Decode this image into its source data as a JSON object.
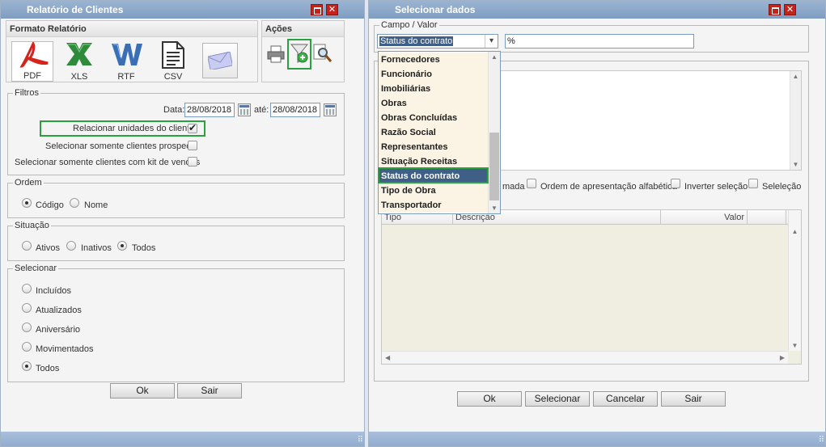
{
  "left_window": {
    "title": "Relatório de Clientes",
    "format_section": {
      "title": "Formato Relatório",
      "formats": [
        {
          "label": "PDF",
          "icon": "pdf-icon",
          "color": "#d4241c"
        },
        {
          "label": "XLS",
          "icon": "excel-icon",
          "color": "#2e8b3a"
        },
        {
          "label": "RTF",
          "icon": "word-icon",
          "color": "#3a6fb5"
        },
        {
          "label": "CSV",
          "icon": "csv-document-icon",
          "color": "#333333"
        },
        {
          "label": "",
          "icon": "email-envelope-icon",
          "color": "#8a8fc8"
        }
      ]
    },
    "actions_section": {
      "title": "Ações",
      "icons": [
        "printer-icon",
        "filter-add-icon",
        "preview-magnifier-icon"
      ]
    },
    "filtros": {
      "legend": "Filtros",
      "date_label": "Data:",
      "date_from": "28/08/2018",
      "ate_label": "até:",
      "date_to": "28/08/2018",
      "options": [
        {
          "label": "Relacionar unidades do cliente",
          "checked": true
        },
        {
          "label": "Selecionar somente clientes prospects",
          "checked": false
        },
        {
          "label": "Selecionar somente clientes com kit de vendas",
          "checked": false
        }
      ]
    },
    "ordem": {
      "legend": "Ordem",
      "options": [
        {
          "label": "Código",
          "selected": true
        },
        {
          "label": "Nome",
          "selected": false
        }
      ]
    },
    "situacao": {
      "legend": "Situação",
      "options": [
        {
          "label": "Ativos",
          "selected": false
        },
        {
          "label": "Inativos",
          "selected": false
        },
        {
          "label": "Todos",
          "selected": true
        }
      ]
    },
    "selecionar": {
      "legend": "Selecionar",
      "options": [
        {
          "label": "Incluídos",
          "selected": false
        },
        {
          "label": "Atualizados",
          "selected": false
        },
        {
          "label": "Aniversário",
          "selected": false
        },
        {
          "label": "Movimentados",
          "selected": false
        },
        {
          "label": "Todos",
          "selected": true
        }
      ]
    },
    "buttons": {
      "ok": "Ok",
      "sair": "Sair"
    },
    "highlight_color": "#2aa040"
  },
  "right_window": {
    "title": "Selecionar dados",
    "campo_legend": "Campo / Valor",
    "campo_selected": "Status do contrato",
    "valor": "%",
    "dropdown_items": [
      "Fornecedores",
      "Funcionário",
      "Imobiliárias",
      "Obras",
      "Obras Concluídas",
      "Razão Social",
      "Representantes",
      "Situação Receitas",
      "Status do contrato",
      "Tipo de Obra",
      "Transportador"
    ],
    "dropdown_selected_index": 8,
    "options_row": [
      {
        "label": "mada",
        "checked": false
      },
      {
        "label": "Ordem de apresentação alfabética",
        "checked": false
      },
      {
        "label": "Inverter seleção",
        "checked": false
      },
      {
        "label": "Seleleção",
        "checked": false
      }
    ],
    "grid_columns": [
      "Tipo",
      "Descrição",
      "Valor"
    ],
    "buttons": {
      "ok": "Ok",
      "selecionar": "Selecionar",
      "cancelar": "Cancelar",
      "sair": "Sair"
    }
  }
}
